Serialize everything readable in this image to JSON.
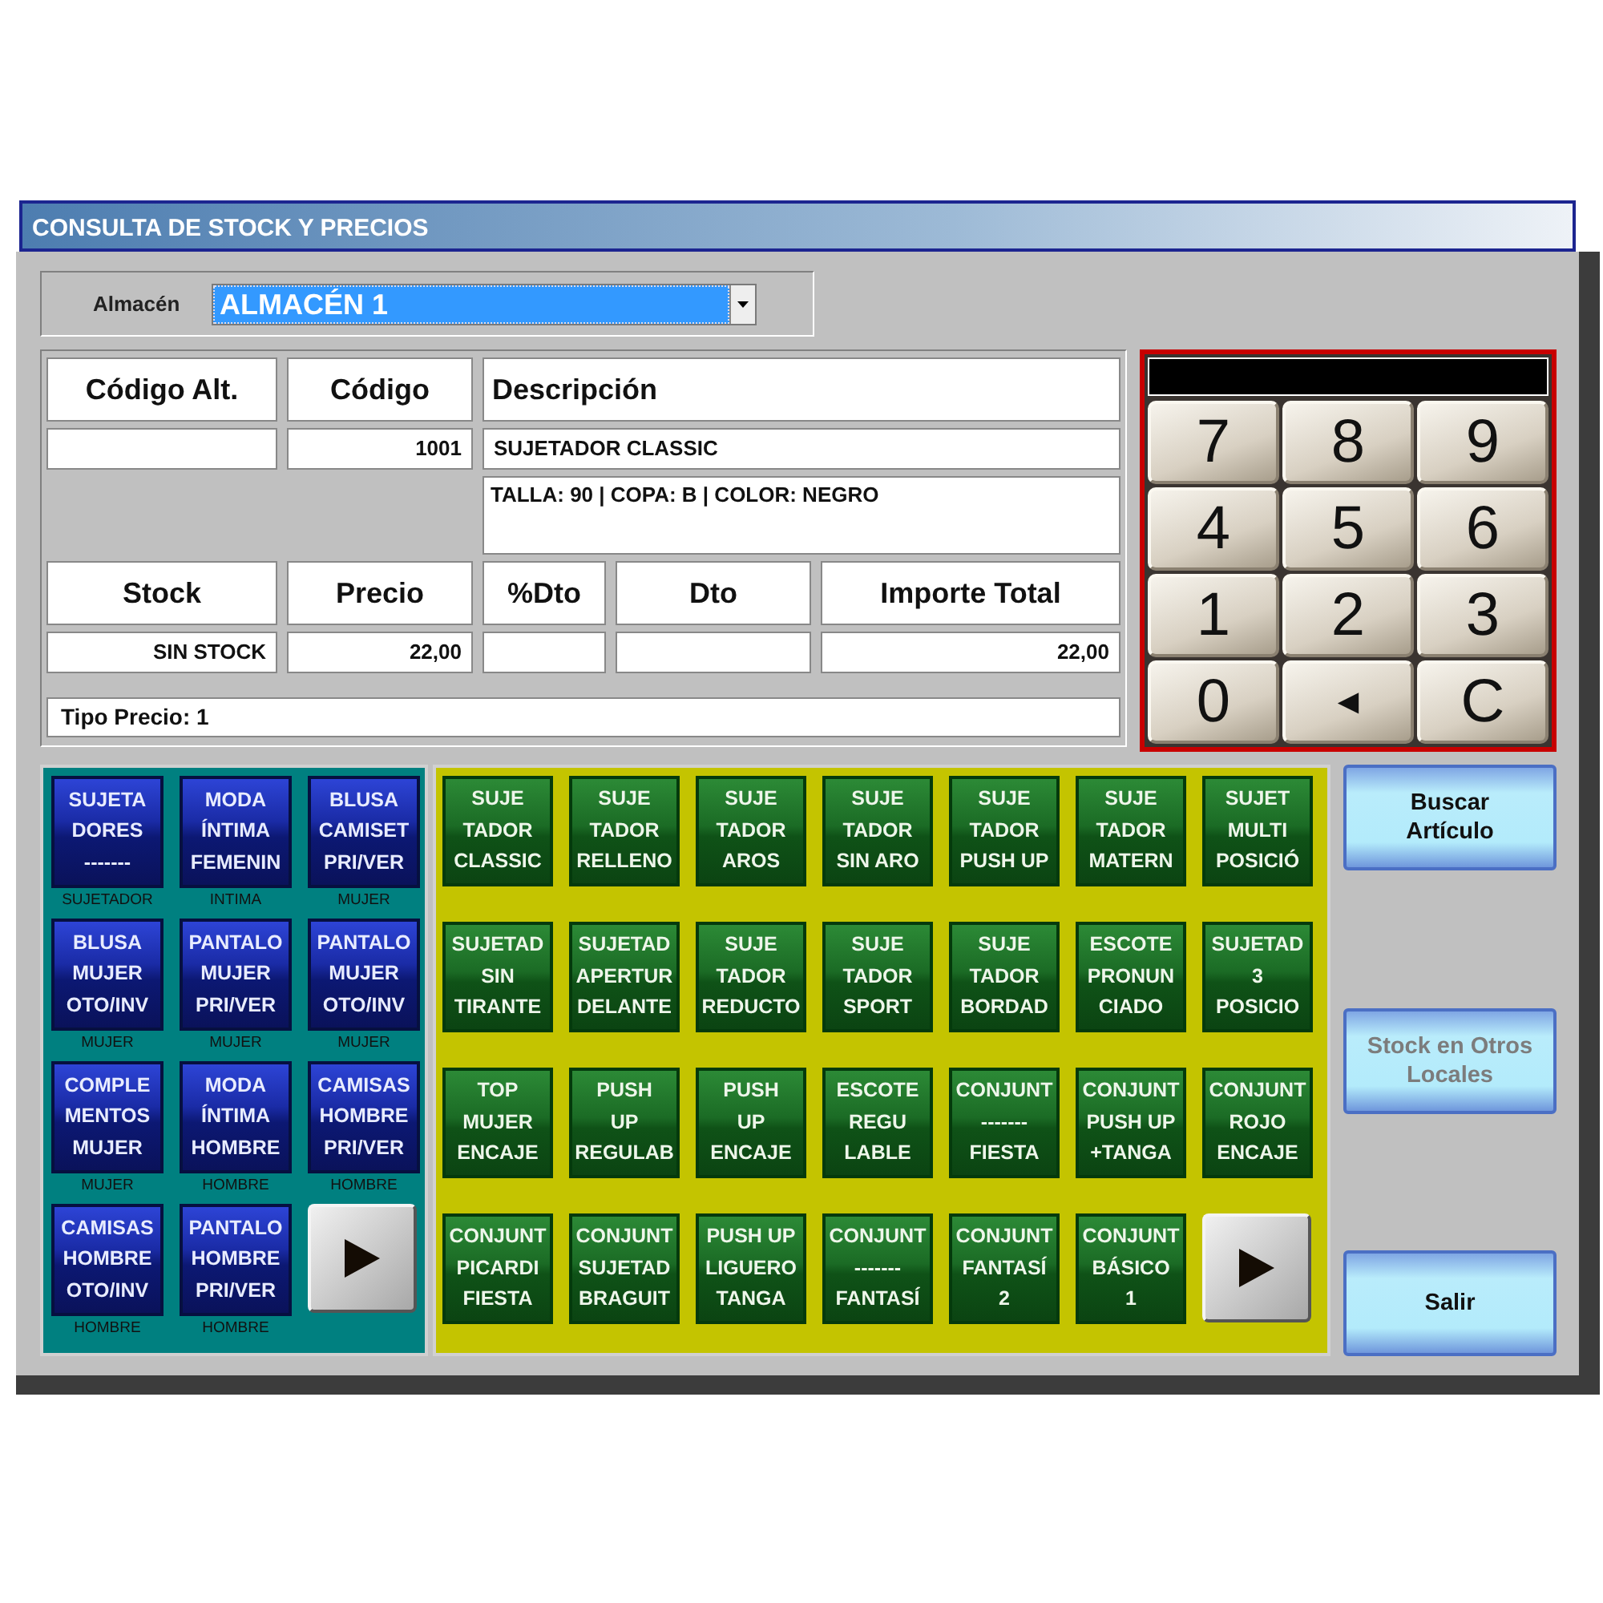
{
  "window": {
    "title": "CONSULTA DE STOCK Y PRECIOS"
  },
  "warehouse": {
    "label": "Almacén",
    "value": "ALMACÉN 1"
  },
  "item_fields": [
    {
      "label": "Código Alt."
    },
    {
      "label": "Código",
      "value": "1001"
    },
    {
      "label": "Descripción",
      "value": "SUJETADOR CLASSIC",
      "detail": "TALLA: 90 | COPA: B | COLOR: NEGRO"
    }
  ],
  "price_fields": [
    {
      "label": "Stock",
      "value": "SIN STOCK"
    },
    {
      "label": "Precio",
      "value": "22,00"
    },
    {
      "label": "%Dto"
    },
    {
      "label": "Dto"
    },
    {
      "label": "Importe Total",
      "value": "22,00"
    }
  ],
  "price_type": "Tipo Precio: 1",
  "keypad": {
    "keys": [
      {
        "label": "7",
        "kind": "digit"
      },
      {
        "label": "8",
        "kind": "digit"
      },
      {
        "label": "9",
        "kind": "digit"
      },
      {
        "label": "4",
        "kind": "digit"
      },
      {
        "label": "5",
        "kind": "digit"
      },
      {
        "label": "6",
        "kind": "digit"
      },
      {
        "label": "1",
        "kind": "digit"
      },
      {
        "label": "2",
        "kind": "digit"
      },
      {
        "label": "3",
        "kind": "digit"
      },
      {
        "label": "0",
        "kind": "digit"
      },
      {
        "label": "◄",
        "kind": "symbol"
      },
      {
        "label": "C",
        "kind": "digit"
      }
    ]
  },
  "families": [
    {
      "label": "SUJETA\nDORES\n-------",
      "caption": "SUJETADOR"
    },
    {
      "label": "MODA\nÍNTIMA\nFEMENIN",
      "caption": "INTIMA"
    },
    {
      "label": "BLUSA\nCAMISET\nPRI/VER",
      "caption": "MUJER"
    },
    {
      "label": "BLUSA\nMUJER\nOTO/INV",
      "caption": "MUJER"
    },
    {
      "label": "PANTALO\nMUJER\nPRI/VER",
      "caption": "MUJER"
    },
    {
      "label": "PANTALO\nMUJER\nOTO/INV",
      "caption": "MUJER"
    },
    {
      "label": "COMPLE\nMENTOS\nMUJER",
      "caption": "MUJER"
    },
    {
      "label": "MODA\nÍNTIMA\nHOMBRE",
      "caption": "HOMBRE"
    },
    {
      "label": "CAMISAS\nHOMBRE\nPRI/VER",
      "caption": "HOMBRE"
    },
    {
      "label": "CAMISAS\nHOMBRE\nOTO/INV",
      "caption": "HOMBRE"
    },
    {
      "label": "PANTALO\nHOMBRE\nPRI/VER",
      "caption": "HOMBRE"
    }
  ],
  "products": [
    "SUJE\nTADOR\nCLASSIC",
    "SUJE\nTADOR\nRELLENO",
    "SUJE\nTADOR\nAROS",
    "SUJE\nTADOR\nSIN ARO",
    "SUJE\nTADOR\nPUSH UP",
    "SUJE\nTADOR\nMATERN",
    "SUJET\nMULTI\nPOSICIÓ",
    "SUJETAD\nSIN\nTIRANTE",
    "SUJETAD\nAPERTUR\nDELANTE",
    "SUJE\nTADOR\nREDUCTO",
    "SUJE\nTADOR\nSPORT",
    "SUJE\nTADOR\nBORDAD",
    "ESCOTE\nPRONUN\nCIADO",
    "SUJETAD\n3\nPOSICIO",
    "TOP\nMUJER\nENCAJE",
    "PUSH\nUP\nREGULAB",
    "PUSH\nUP\nENCAJE",
    "ESCOTE\nREGU\nLABLE",
    "CONJUNT\n-------\nFIESTA",
    "CONJUNT\nPUSH UP\n+TANGA",
    "CONJUNT\nROJO\nENCAJE",
    "CONJUNT\nPICARDI\nFIESTA",
    "CONJUNT\nSUJETAD\nBRAGUIT",
    "PUSH UP\nLIGUERO\nTANGA",
    "CONJUNT\n-------\nFANTASÍ",
    "CONJUNT\nFANTASÍ\n2",
    "CONJUNT\nBÁSICO\n1"
  ],
  "actions": [
    {
      "label": "Buscar\nArtículo",
      "disabled": false
    },
    {
      "label": "Stock en Otros\nLocales",
      "disabled": true
    },
    {
      "label": "Salir",
      "disabled": false
    }
  ]
}
